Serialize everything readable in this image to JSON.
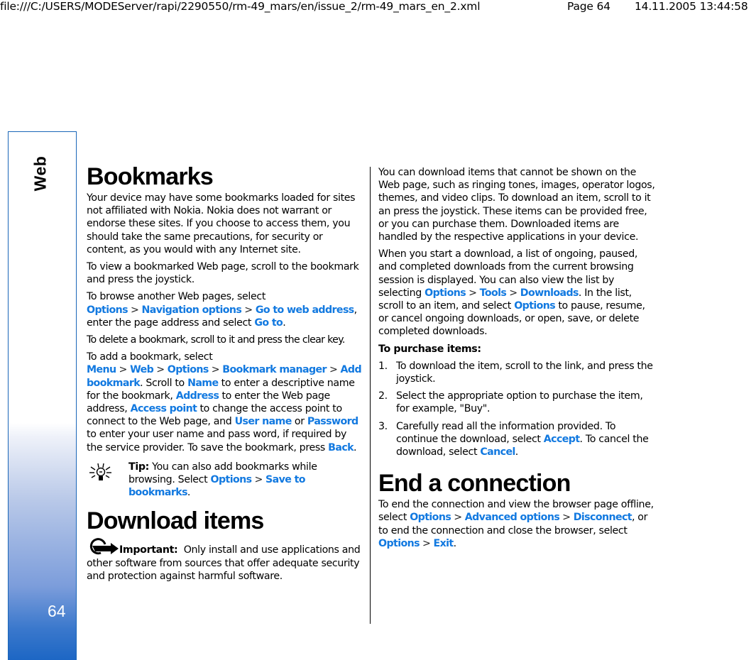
{
  "header": {
    "file_path": "file:///C:/USERS/MODEServer/rapi/2290550/rm-49_mars/en/issue_2/rm-49_mars_en_2.xml",
    "page_label": "Page 64",
    "timestamp": "14.11.2005 13:44:58"
  },
  "sidebar": {
    "section": "Web",
    "page_number": "64",
    "accent_color": "#1c66c4"
  },
  "colors": {
    "link": "#1279e0",
    "text": "#000000"
  },
  "separator": ">",
  "left": {
    "bookmarks_title": "Bookmarks",
    "p1": "Your device may have some bookmarks loaded for sites not affiliated with Nokia. Nokia does not warrant or endorse these sites. If you choose to access them, you should take the same precautions, for security or content, as you would with any Internet site.",
    "p2": "To view a bookmarked Web page, scroll to the bookmark and press the joystick.",
    "p3": {
      "t1": "To browse another Web pages, select ",
      "l1": "Options",
      "l2": "Navigation options",
      "l3": "Go to web address",
      "t2": ", enter the page address and select ",
      "l4": "Go to",
      "t3": "."
    },
    "p4": "To delete a bookmark, scroll to it and press the clear key.",
    "p5": {
      "t1": "To add a bookmark, select ",
      "l1": "Menu",
      "l2": "Web",
      "l3": "Options",
      "l4": "Bookmark manager",
      "l5": "Add bookmark",
      "t2": ". Scroll to ",
      "l6": "Name",
      "t3": " to enter a descriptive name for the bookmark, ",
      "l7": "Address",
      "t4": " to enter the Web page address, ",
      "l8": "Access point",
      "t5": " to change the access point to connect to the Web page, and ",
      "l9": "User name",
      "t6": " or ",
      "l10": "Password",
      "t7": " to enter your user name and pass word, if required by the service provider. To save the bookmark, press ",
      "l11": "Back",
      "t8": "."
    },
    "tip": {
      "label": "Tip:",
      "t1": " You can also add bookmarks while browsing. Select ",
      "l1": "Options",
      "l2": "Save to bookmarks",
      "t2": "."
    },
    "download_title": "Download items",
    "important": {
      "label": "Important:",
      "text": "  Only install and use applications and other software from sources that offer adequate security and protection against harmful software."
    }
  },
  "right": {
    "p1": "You can download items that cannot be shown on the Web page, such as ringing tones, images, operator logos, themes, and video clips. To download an item, scroll to it an press the joystick. These items can be provided free, or you can purchase them. Downloaded items are handled by the respective applications in your device.",
    "p2": {
      "t1": "When you start a download, a list of ongoing, paused, and completed downloads from the current browsing session is displayed. You can also view the list by selecting ",
      "l1": "Options",
      "l2": "Tools",
      "l3": "Downloads",
      "t2": ". In the list, scroll to an item, and select ",
      "l4": "Options",
      "t3": " to pause, resume, or cancel ongoing downloads, or open, save, or delete completed downloads."
    },
    "purchase_heading": "To purchase items:",
    "steps": [
      {
        "num": "1.",
        "text": "To download the item, scroll to the link, and press the joystick."
      },
      {
        "num": "2.",
        "text": "Select the appropriate option to purchase the item, for example, \"Buy\"."
      },
      {
        "num": "3.",
        "t1": "Carefully read all the information provided. To continue the download, select ",
        "l1": "Accept",
        "t2": ". To cancel the download, select ",
        "l2": "Cancel",
        "t3": "."
      }
    ],
    "end_title": "End a connection",
    "end_p": {
      "t1": "To end the connection and view the browser page offline, select ",
      "l1": "Options",
      "l2": "Advanced options",
      "l3": "Disconnect",
      "t2": ", or to end the connection and close the browser, select ",
      "l4": "Options",
      "l5": "Exit",
      "t3": "."
    }
  }
}
